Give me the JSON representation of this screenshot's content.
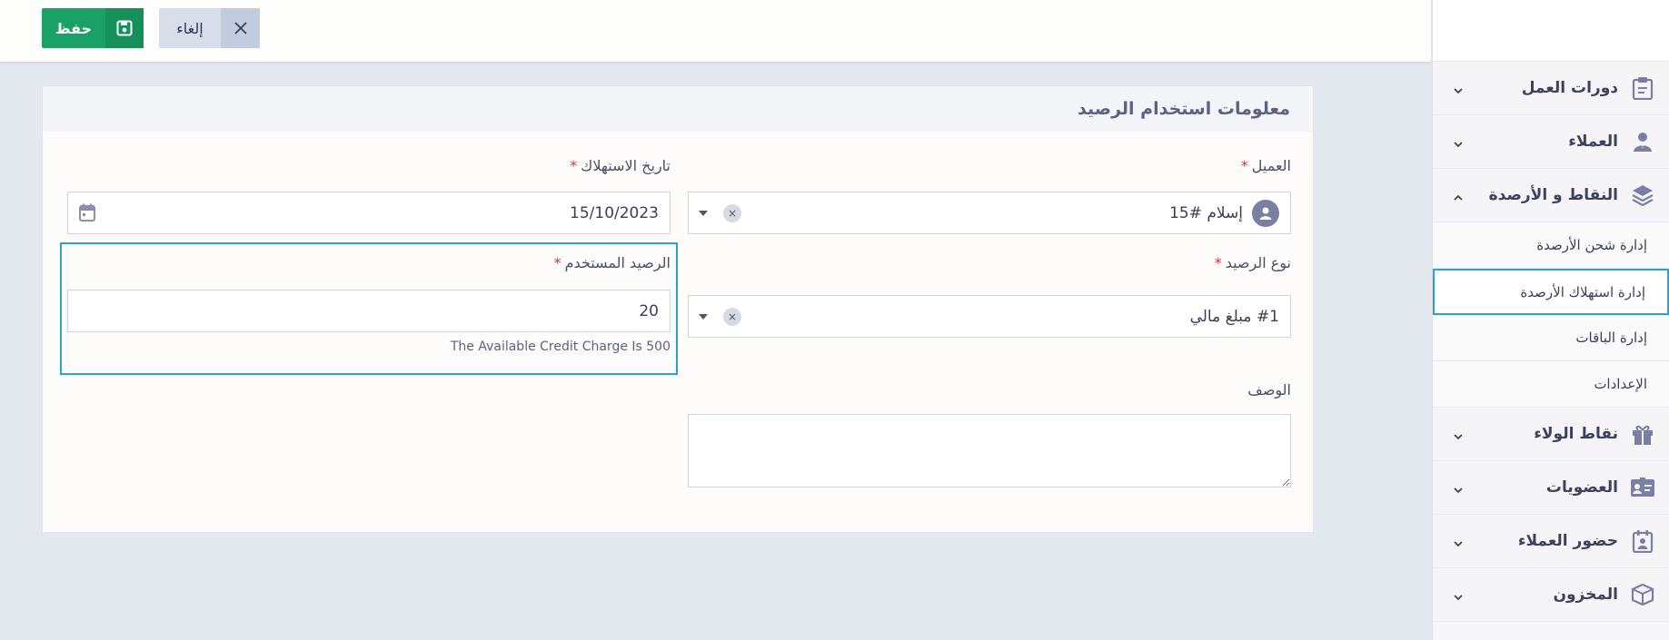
{
  "toolbar": {
    "save_label": "حفظ",
    "cancel_label": "إلغاء"
  },
  "panel": {
    "title": "معلومات استخدام الرصيد"
  },
  "form": {
    "customer": {
      "label": "العميل",
      "value": "إسلام #15"
    },
    "consumption_date": {
      "label": "تاريخ الاستهلاك",
      "value": "15/10/2023"
    },
    "balance_type": {
      "label": "نوع الرصيد",
      "value": "#1 مبلغ مالي"
    },
    "used_balance": {
      "label": "الرصيد المستخدم",
      "value": "20",
      "hint": "The Available Credit Charge Is 500"
    },
    "description": {
      "label": "الوصف",
      "value": ""
    },
    "required_mark": "*"
  },
  "sidebar": {
    "items": [
      {
        "label": "دورات العمل",
        "icon": "clipboard-icon",
        "expanded": false
      },
      {
        "label": "العملاء",
        "icon": "user-icon",
        "expanded": false
      },
      {
        "label": "النقاط و الأرصدة",
        "icon": "layers-icon",
        "expanded": true
      }
    ],
    "sub_items": [
      {
        "label": "إدارة شحن الأرصدة"
      },
      {
        "label": "إدارة استهلاك الأرصدة"
      },
      {
        "label": "إدارة الباقات"
      },
      {
        "label": "الإعدادات"
      }
    ],
    "items_after": [
      {
        "label": "نقاط الولاء",
        "icon": "gift-icon"
      },
      {
        "label": "العضويات",
        "icon": "id-card-icon"
      },
      {
        "label": "حضور العملاء",
        "icon": "calendar-user-icon"
      },
      {
        "label": "المخزون",
        "icon": "box-icon"
      }
    ]
  },
  "colors": {
    "accent": "#2b9fd8",
    "save": "#1aa167",
    "required": "#e02d3c"
  }
}
